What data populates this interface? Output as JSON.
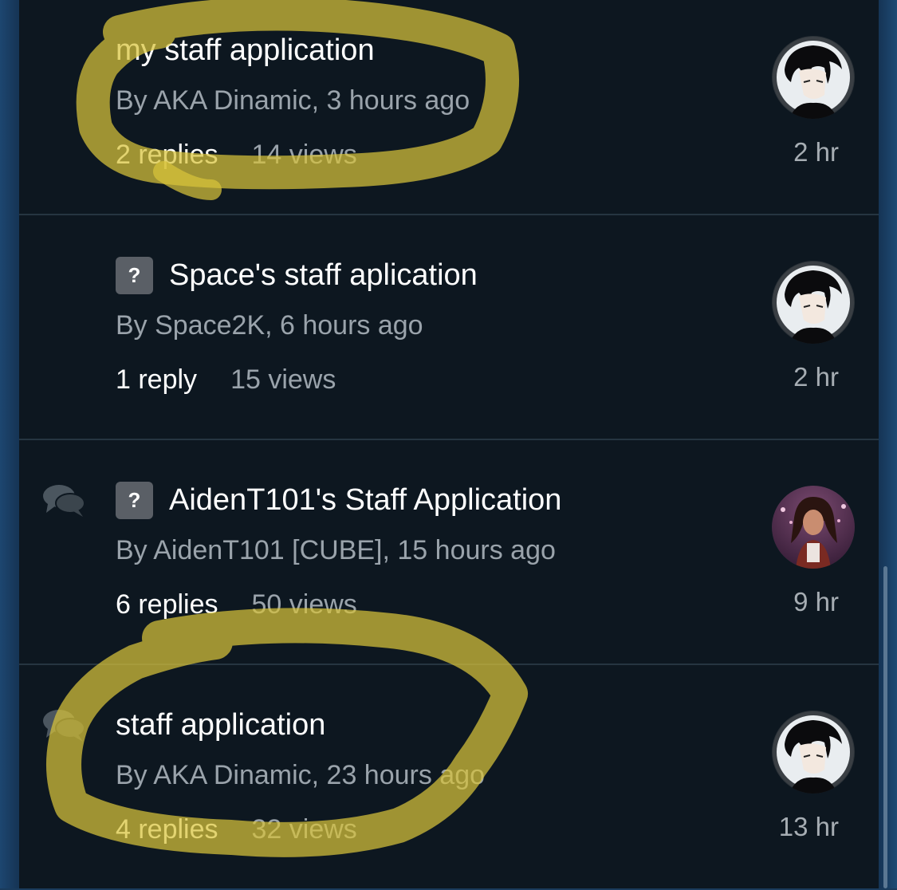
{
  "topics": [
    {
      "title": "my staff application",
      "byline": "By AKA Dinamic, 3 hours ago",
      "replies": "2 replies",
      "views": "14 views",
      "time": "2 hr",
      "question_badge": ""
    },
    {
      "title": "Space's staff aplication",
      "byline": "By Space2K, 6 hours ago",
      "replies": "1 reply",
      "views": "15 views",
      "time": "2 hr",
      "question_badge": "?"
    },
    {
      "title": "AidenT101's Staff Application",
      "byline": "By AidenT101 [CUBE], 15 hours ago",
      "replies": "6 replies",
      "views": "50 views",
      "time": "9 hr",
      "question_badge": "?"
    },
    {
      "title": "staff application",
      "byline": "By AKA Dinamic, 23 hours ago",
      "replies": "4 replies",
      "views": "32 views",
      "time": "13 hr",
      "question_badge": ""
    }
  ],
  "icons": {
    "chat": "chat-bubbles-icon",
    "question": "question-badge-icon"
  },
  "colors": {
    "background": "#0d1720",
    "highlight": "#d8c43a",
    "secondary_text": "#9aa3ab"
  }
}
